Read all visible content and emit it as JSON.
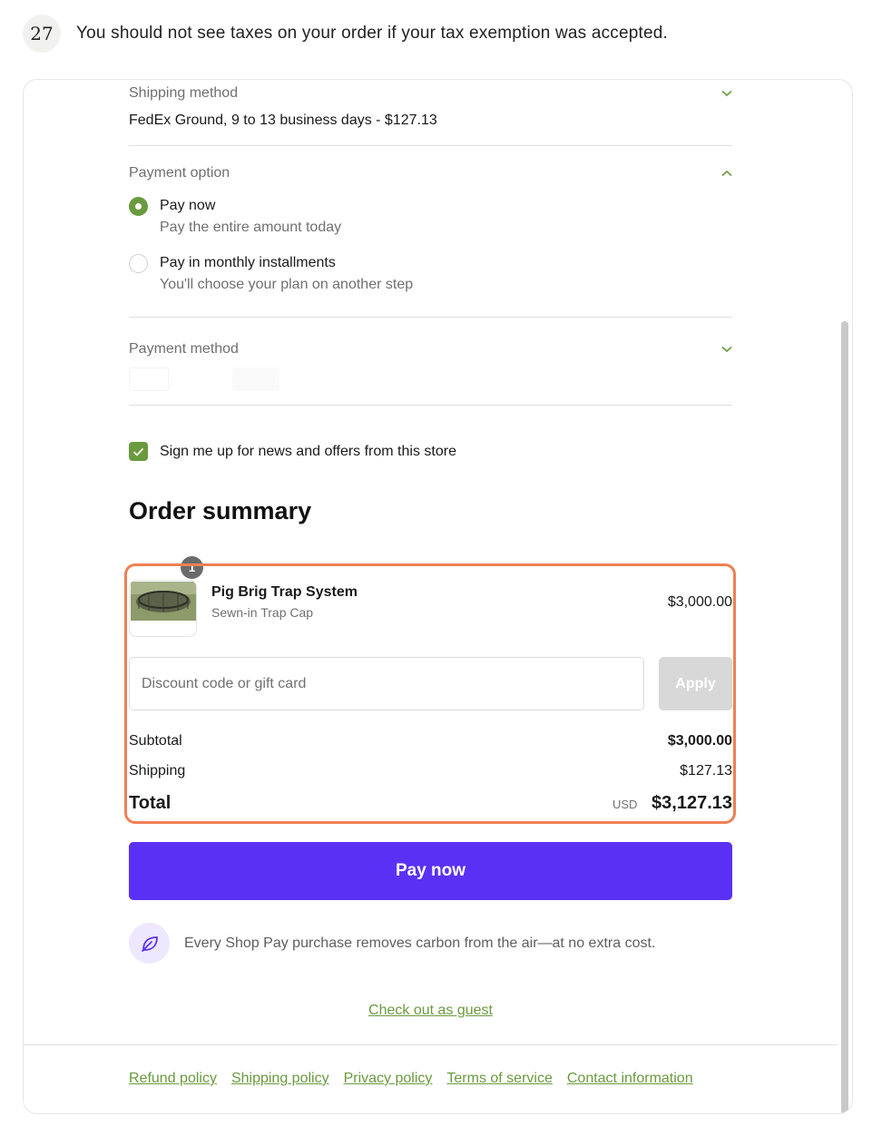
{
  "step": {
    "number": "27",
    "text": "You should not see taxes on your order if your tax exemption was accepted."
  },
  "shipping": {
    "label": "Shipping method",
    "value": "FedEx Ground, 9 to 13 business days - $127.13"
  },
  "payment_option": {
    "label": "Payment option",
    "options": [
      {
        "title": "Pay now",
        "subtitle": "Pay the entire amount today",
        "selected": true
      },
      {
        "title": "Pay in monthly installments",
        "subtitle": "You'll choose your plan on another step",
        "selected": false
      }
    ]
  },
  "payment_method": {
    "label": "Payment method"
  },
  "newsletter": {
    "label": "Sign me up for news and offers from this store",
    "checked": true
  },
  "order_summary": {
    "title": "Order summary",
    "item": {
      "quantity": "1",
      "name": "Pig Brig Trap System",
      "variant": "Sewn-in Trap Cap",
      "price": "$3,000.00"
    },
    "discount": {
      "placeholder": "Discount code or gift card",
      "apply_label": "Apply"
    },
    "subtotal_label": "Subtotal",
    "subtotal_value": "$3,000.00",
    "shipping_label": "Shipping",
    "shipping_value": "$127.13",
    "total_label": "Total",
    "currency": "USD",
    "total_value": "$3,127.13"
  },
  "pay_button": "Pay now",
  "carbon_text": "Every Shop Pay purchase removes carbon from the air—at no extra cost.",
  "guest_link": "Check out as guest",
  "footer_links": [
    "Refund policy",
    "Shipping policy",
    "Privacy policy",
    "Terms of service",
    "Contact information"
  ],
  "colors": {
    "accent_green": "#6a9a3f",
    "shop_pay_purple": "#5a31f4",
    "highlight_orange": "#f07f54"
  },
  "icons": [
    "chevron-down-icon",
    "chevron-up-icon",
    "check-icon",
    "leaf-icon"
  ]
}
